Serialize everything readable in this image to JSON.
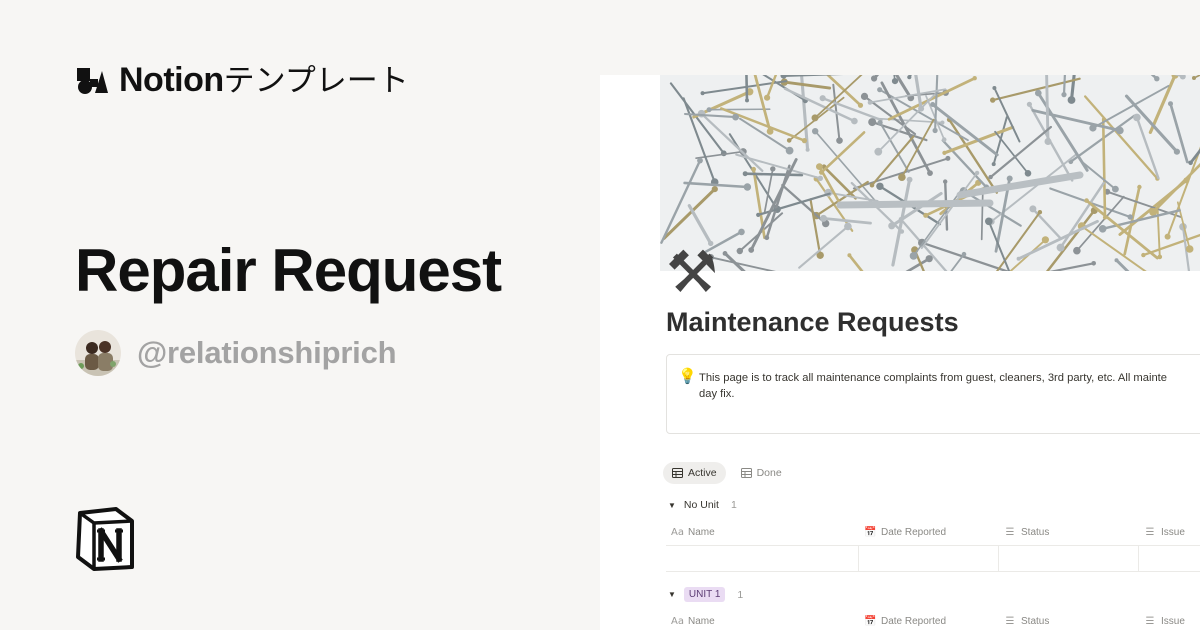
{
  "brand": {
    "name_strong": "Notion",
    "name_rest": "テンプレート"
  },
  "template_title": "Repair Request",
  "author": {
    "handle": "@relationshiprich"
  },
  "page": {
    "icon": "⚒",
    "title": "Maintenance Requests",
    "callout": {
      "icon": "lightbulb-icon",
      "line1": "This page is to track all maintenance complaints from guest, cleaners, 3rd party, etc. All mainte",
      "line2": "day fix."
    },
    "views": [
      {
        "label": "Active",
        "icon": "table-icon"
      },
      {
        "label": "Done",
        "icon": "table-icon"
      }
    ],
    "columns": [
      {
        "label": "Name",
        "icon": "Aa"
      },
      {
        "label": "Date Reported",
        "icon": "calendar-icon"
      },
      {
        "label": "Status",
        "icon": "list-icon"
      },
      {
        "label": "Issue",
        "icon": "list-icon"
      }
    ],
    "groups": [
      {
        "label": "No Unit",
        "count": "1",
        "toggle": "▼"
      },
      {
        "label": "UNIT 1",
        "count": "1",
        "toggle": "▼"
      }
    ]
  },
  "colors": {
    "background": "#f7f6f4",
    "handle": "#a3a3a3",
    "unit_tag_bg": "#eadcf3"
  }
}
